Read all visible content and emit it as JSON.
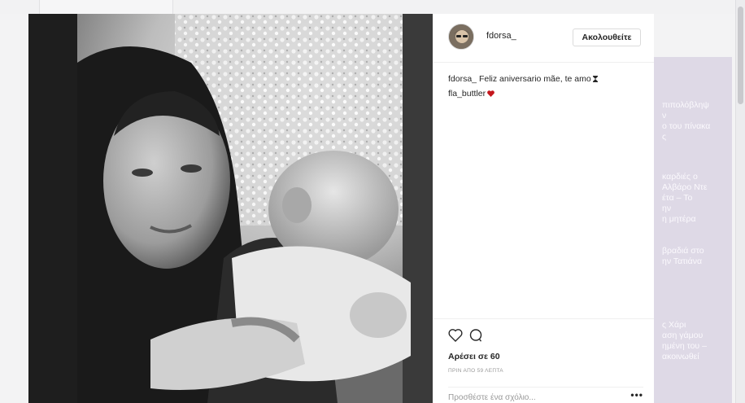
{
  "post": {
    "username": "fdorsa_",
    "follow_label": "Ακολουθείτε",
    "caption_user": "fdorsa_",
    "caption_text": "Feliz aniversario mãe, te amo",
    "mention": "fla_buttler",
    "likes": "Αρέσει σε 60",
    "time": "ΠΡΙΝ ΑΠΟ 59 ΛΕΠΤΑ",
    "comment_placeholder": "Προσθέστε ένα σχόλιο...",
    "more_label": "•••"
  },
  "background": {
    "headlines": [
      "πιπολόβληψ\nν\nο του πίνακα\nς",
      "καρδιές ο\nΑλβάρο Ντε\nέτα – Το\nην\nη μητέρα",
      "βραδιά στο\nην Τατιάνα",
      "ς Χάρι\nαση γάμου\nημένη του –\nακοινωθεί"
    ]
  },
  "icons": {
    "like": "heart-outline-icon",
    "comment": "speech-bubble-icon",
    "hourglass": "hourglass-emoji-icon",
    "heart": "red-heart-emoji-icon"
  },
  "colors": {
    "heart_red": "#c4161c",
    "text": "#262626",
    "muted": "#999999",
    "side_panel": "#ded9e6"
  }
}
